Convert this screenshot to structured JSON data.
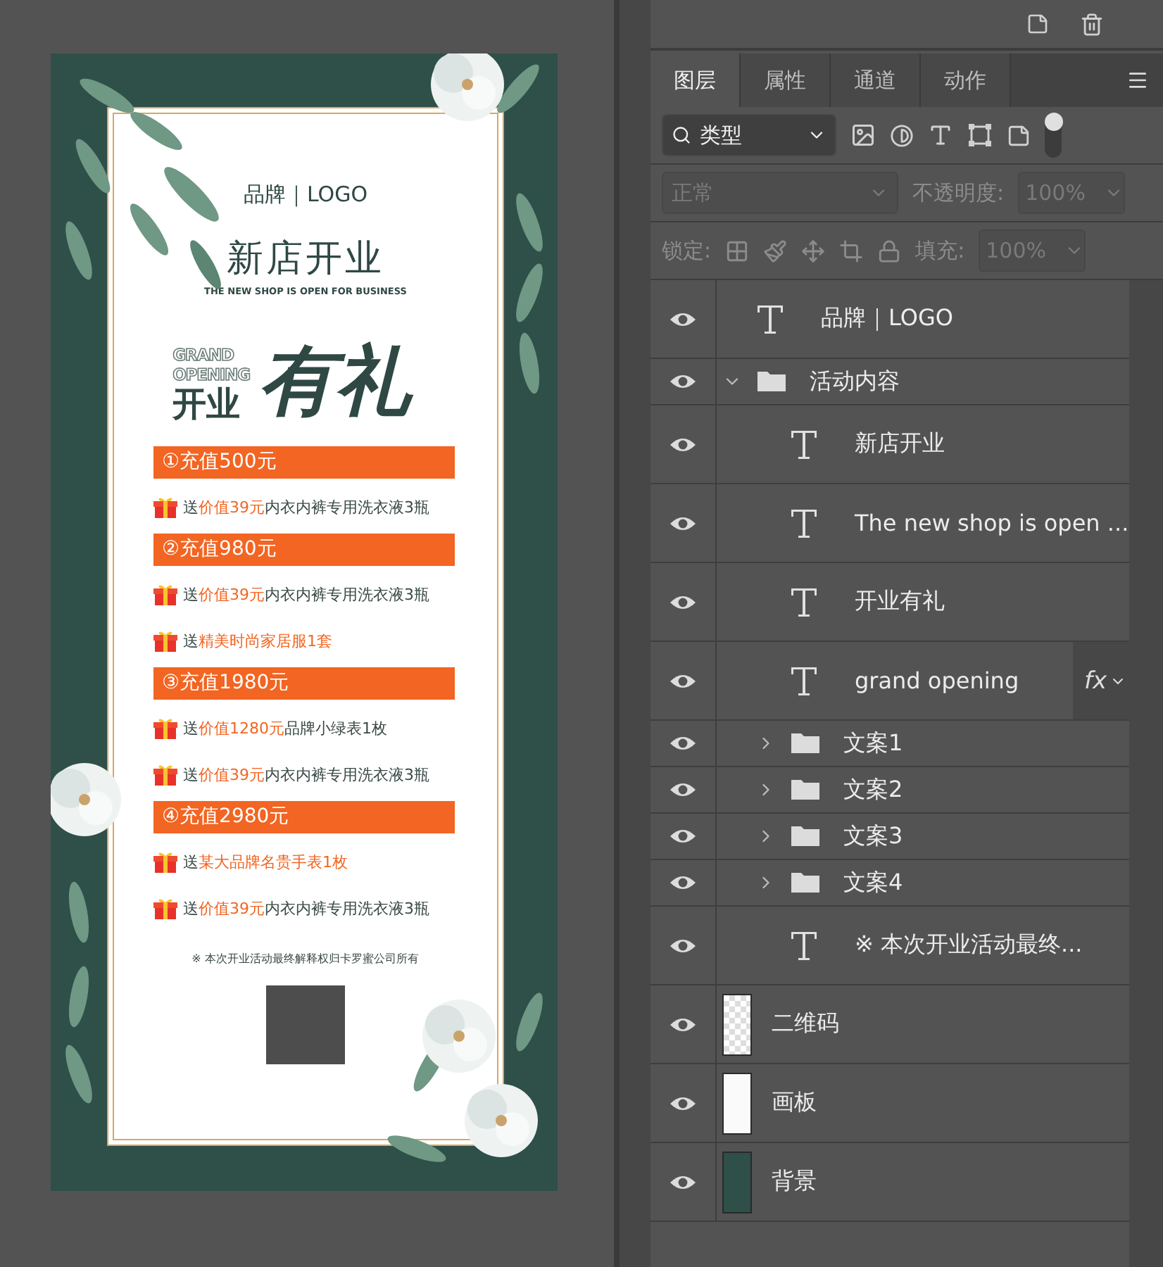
{
  "poster": {
    "brand": "品牌｜LOGO",
    "title": "新店开业",
    "subtitle": "THE NEW SHOP IS OPEN FOR BUSINESS",
    "grand": "GRAND",
    "opening": "OPENING",
    "kaiye": "开业",
    "youli": "有礼",
    "tiers": [
      {
        "heading": "①充值500元",
        "gifts": [
          {
            "prefix": "送",
            "highlight": "价值39元",
            "rest": "内衣内裤专用洗衣液3瓶"
          }
        ]
      },
      {
        "heading": "②充值980元",
        "gifts": [
          {
            "prefix": "送",
            "highlight": "价值39元",
            "rest": "内衣内裤专用洗衣液3瓶"
          },
          {
            "prefix": "送",
            "highlight": "精美时尚家居服1套"
          }
        ]
      },
      {
        "heading": "③充值1980元",
        "gifts": [
          {
            "prefix": "送",
            "highlight": "价值1280元",
            "rest": "品牌小绿表1枚"
          },
          {
            "prefix": "送",
            "highlight": "价值39元",
            "rest": "内衣内裤专用洗衣液3瓶"
          }
        ]
      },
      {
        "heading": "④充值2980元",
        "gifts": [
          {
            "prefix": "送",
            "highlight": "某大品牌名贵手表1枚"
          },
          {
            "prefix": "送",
            "highlight": "价值39元",
            "rest": "内衣内裤专用洗衣液3瓶"
          }
        ]
      }
    ],
    "note": "※  本次开业活动最终解释权归卡罗蜜公司所有"
  },
  "panel": {
    "tabs": [
      {
        "label": "图层",
        "selected": true
      },
      {
        "label": "属性",
        "selected": false
      },
      {
        "label": "通道",
        "selected": false
      },
      {
        "label": "动作",
        "selected": false
      }
    ],
    "filter": {
      "value": "类型",
      "on": true
    },
    "blend": {
      "value": "正常",
      "disabled": true
    },
    "opacity": {
      "label": "不透明度:",
      "value": "100%",
      "disabled": true
    },
    "lock": {
      "label": "锁定:"
    },
    "fill": {
      "label": "填充:",
      "value": "100%",
      "disabled": true
    },
    "layers": [
      {
        "kind": "text",
        "name": "品牌｜LOGO",
        "visible": true
      },
      {
        "kind": "group",
        "name": "活动内容",
        "visible": true,
        "expanded": true,
        "children": [
          {
            "kind": "text",
            "name": "新店开业",
            "visible": true
          },
          {
            "kind": "text",
            "name": "The new shop is open ...",
            "visible": true
          },
          {
            "kind": "text",
            "name": "开业有礼",
            "visible": true
          },
          {
            "kind": "text",
            "name": "grand  opening",
            "visible": true,
            "effects": "fx"
          },
          {
            "kind": "group",
            "name": "文案1",
            "visible": true,
            "expanded": false
          },
          {
            "kind": "group",
            "name": "文案2",
            "visible": true,
            "expanded": false
          },
          {
            "kind": "group",
            "name": "文案3",
            "visible": true,
            "expanded": false
          },
          {
            "kind": "group",
            "name": "文案4",
            "visible": true,
            "expanded": false
          },
          {
            "kind": "text",
            "name": "※ 本次开业活动最终...",
            "visible": true
          }
        ]
      },
      {
        "kind": "transparent",
        "name": "二维码",
        "visible": true
      },
      {
        "kind": "artwork",
        "name": "画板",
        "visible": true
      },
      {
        "kind": "fill",
        "name": "背景",
        "visible": true
      }
    ]
  }
}
